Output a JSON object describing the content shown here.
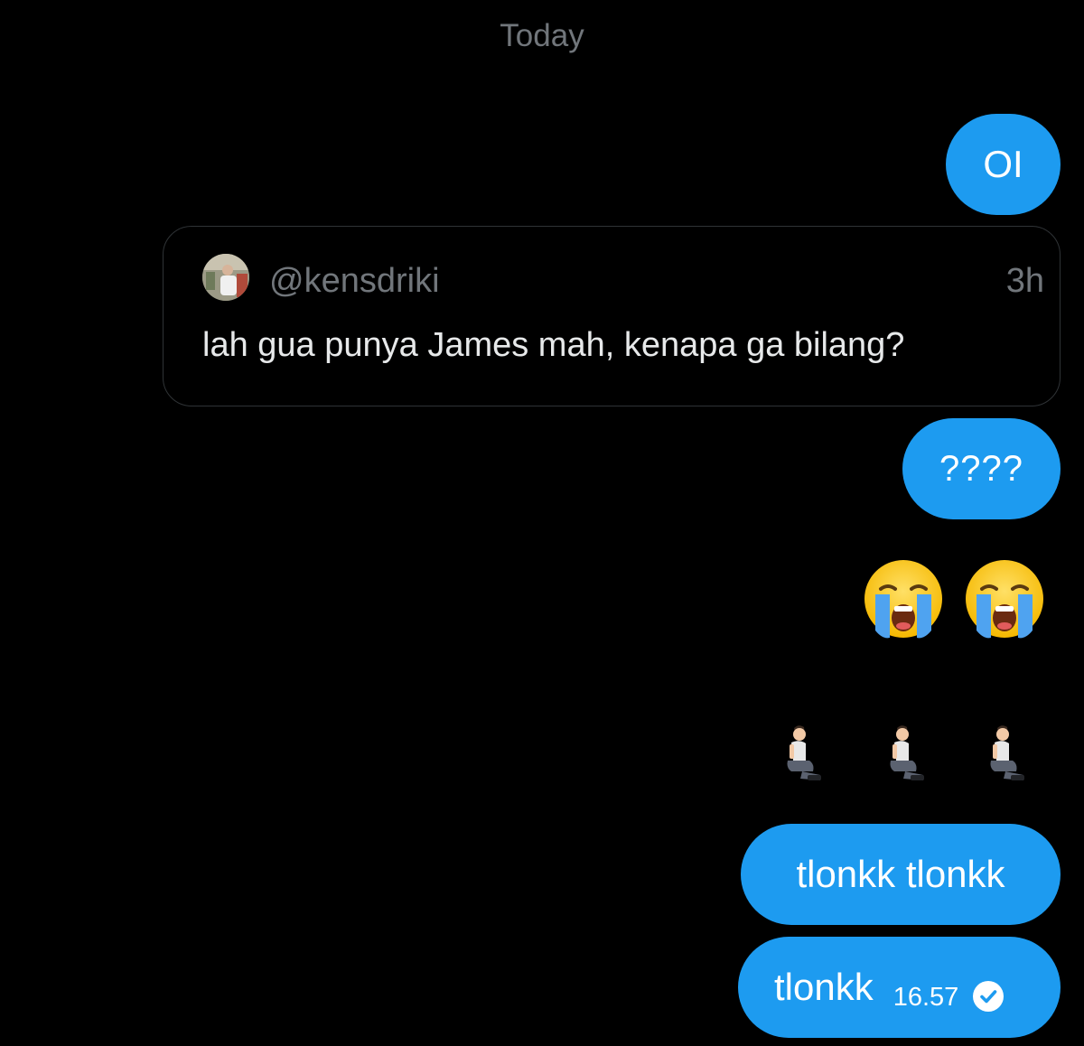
{
  "conversation": {
    "date_separator": "Today"
  },
  "messages": {
    "oi": {
      "text": "OI"
    },
    "quoted_post": {
      "handle": "@kensdriki",
      "time": "3h",
      "text": "lah gua punya James mah, kenapa ga bilang?"
    },
    "question": {
      "text": "????"
    },
    "crying_emojis": [
      "loudly-crying-face-icon",
      "loudly-crying-face-icon"
    ],
    "kneeling_emojis": [
      "person-kneeling-icon",
      "person-kneeling-icon",
      "person-kneeling-icon"
    ],
    "tlonkk_double": {
      "text": "tlonkk tlonkk"
    },
    "tlonkk_last": {
      "text": "tlonkk",
      "time": "16.57",
      "status": "seen-check-icon"
    }
  },
  "colors": {
    "background": "#000000",
    "sent_bubble": "#1d9bf0",
    "muted_text": "#71767b",
    "primary_text": "#e7e9ea",
    "card_border": "#2f3336"
  }
}
